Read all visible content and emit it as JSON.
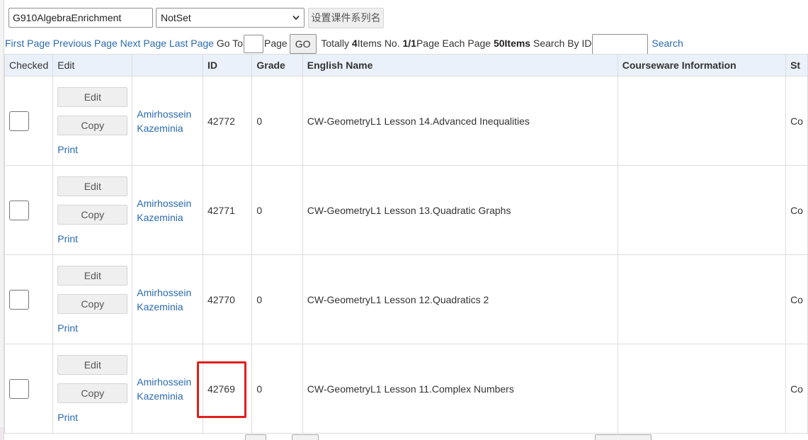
{
  "toolbar": {
    "series_value": "G910AlgebraEnrichment",
    "select_value": "NotSet",
    "set_series_label": "设置课件系列名"
  },
  "pager": {
    "first": "First Page",
    "previous": "Previous Page",
    "next": "Next Page",
    "last": "Last Page",
    "goto_label": "Go To",
    "page_label": "Page",
    "go_button": "GO",
    "totally_label": "Totally",
    "total_count": "4",
    "items_no_label": "Items No.",
    "page_of": "1/1",
    "page_each_label": "Page Each Page",
    "page_size": "50Items",
    "search_by_id_label": "Search By ID",
    "search_link": "Search"
  },
  "table": {
    "headers": {
      "checked": "Checked",
      "edit": "Edit",
      "author": "",
      "id": "ID",
      "grade": "Grade",
      "english_name": "English Name",
      "courseware_information": "Courseware Information",
      "status_partial": "St"
    },
    "edit_label": "Edit",
    "copy_label": "Copy",
    "print_label": "Print",
    "rows": [
      {
        "author_first": "Amirhossein",
        "author_last": "Kazeminia",
        "id": "42772",
        "grade": "0",
        "english_name": "CW-GeometryL1 Lesson 14.Advanced Inequalities",
        "info": "",
        "status_partial": "Co"
      },
      {
        "author_first": "Amirhossein",
        "author_last": "Kazeminia",
        "id": "42771",
        "grade": "0",
        "english_name": "CW-GeometryL1 Lesson 13.Quadratic Graphs",
        "info": "",
        "status_partial": "Co"
      },
      {
        "author_first": "Amirhossein",
        "author_last": "Kazeminia",
        "id": "42770",
        "grade": "0",
        "english_name": "CW-GeometryL1 Lesson 12.Quadratics 2",
        "info": "",
        "status_partial": "Co"
      },
      {
        "author_first": "Amirhossein",
        "author_last": "Kazeminia",
        "id": "42769",
        "grade": "0",
        "english_name": "CW-GeometryL1 Lesson 11.Complex Numbers",
        "info": "",
        "status_partial": "Co"
      }
    ]
  },
  "colors": {
    "link": "#2a6bb0",
    "header_bg": "#eaf1fa",
    "highlight": "#e0201b"
  }
}
